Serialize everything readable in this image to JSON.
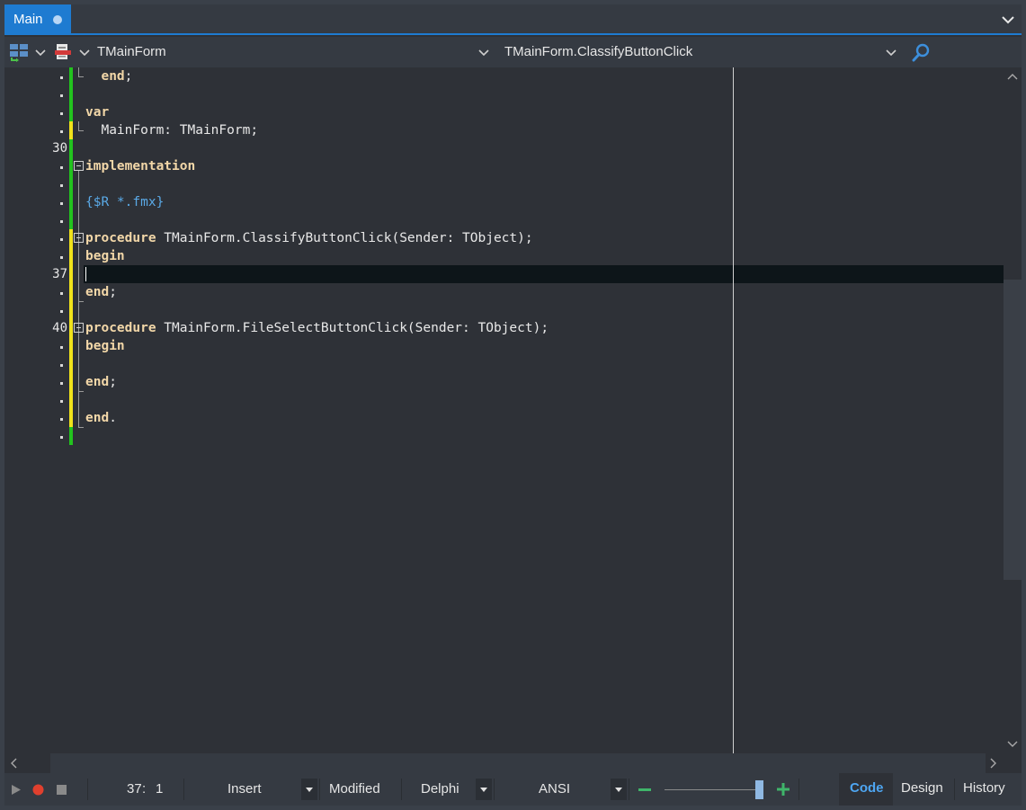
{
  "tabs": [
    {
      "label": "Main",
      "modified": true
    }
  ],
  "nav": {
    "class_selector": "TMainForm",
    "method_selector": "TMainForm.ClassifyButtonClick"
  },
  "editor": {
    "line_numbers": [
      {
        "label": "30"
      },
      {
        "label": "37"
      },
      {
        "label": "40"
      }
    ],
    "lines": {
      "l1_kw": "end",
      "l1_rest": ";",
      "l3_kw": "var",
      "l4": "  MainForm: TMainForm;",
      "l6_kw": "implementation",
      "l8": "{$R *.fmx}",
      "l10_kw": "procedure",
      "l10_rest": " TMainForm.ClassifyButtonClick(Sender: TObject);",
      "l11_kw": "begin",
      "l13_kw": "end",
      "l13_rest": ";",
      "l15_kw": "procedure",
      "l15_rest": " TMainForm.FileSelectButtonClick(Sender: TObject);",
      "l16_kw": "begin",
      "l18_kw": "end",
      "l18_rest": ";",
      "l20_kw": "end",
      "l20_rest": "."
    },
    "colors": {
      "keyword": "#f2d7a8",
      "directive": "#5aa9e6",
      "saved_change": "#22c31e",
      "unsaved_change": "#f0e21b"
    }
  },
  "status": {
    "cursor_line": "37",
    "cursor_col": "1",
    "insert_mode": "Insert",
    "modified": "Modified",
    "language": "Delphi",
    "encoding": "ANSI"
  },
  "view_tabs": {
    "code": "Code",
    "design": "Design",
    "history": "History",
    "active": "Code"
  }
}
